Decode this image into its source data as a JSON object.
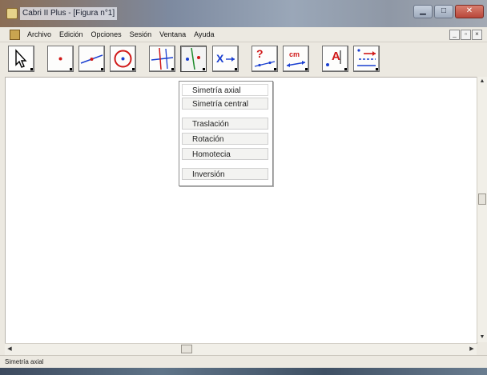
{
  "window": {
    "title": "Cabri II Plus - [Figura n°1]",
    "controls": {
      "minimize": "▁",
      "maximize": "□",
      "close": "✕"
    }
  },
  "menubar": {
    "items": [
      "Archivo",
      "Edición",
      "Opciones",
      "Sesión",
      "Ventana",
      "Ayuda"
    ],
    "doc_controls": {
      "minimize": "_",
      "restore": "▫",
      "close": "×"
    }
  },
  "toolbar": {
    "tools": [
      {
        "name": "pointer-tool",
        "icon": "arrow-pointer-icon"
      },
      {
        "name": "point-tool",
        "icon": "point-icon"
      },
      {
        "name": "line-tool",
        "icon": "line-icon"
      },
      {
        "name": "circle-tool",
        "icon": "circle-icon"
      },
      {
        "name": "construct-tool",
        "icon": "perpendicular-lines-icon"
      },
      {
        "name": "transform-tool",
        "icon": "axial-symmetry-icon",
        "active": true
      },
      {
        "name": "macro-tool",
        "icon": "macro-x-arrow-icon",
        "label": "X"
      },
      {
        "name": "check-property-tool",
        "icon": "question-mark-icon",
        "label": "?"
      },
      {
        "name": "measure-tool",
        "icon": "measure-cm-icon",
        "label": "cm"
      },
      {
        "name": "display-tool",
        "icon": "text-label-icon",
        "label": "A"
      },
      {
        "name": "draw-tool",
        "icon": "draw-attributes-icon"
      }
    ]
  },
  "transform_menu": {
    "items": [
      "Simetría axial",
      "Simetría central",
      "Traslación",
      "Rotación",
      "Homotecia",
      "Inversión"
    ],
    "selected_index": 0
  },
  "scrollbars": {
    "up": "▲",
    "down": "▼",
    "left": "◀",
    "right": "▶"
  },
  "status": {
    "text": "Simetría axial"
  },
  "colors": {
    "accent_red": "#d01818",
    "accent_blue": "#1a3fd0",
    "accent_green": "#1c8a2a"
  }
}
